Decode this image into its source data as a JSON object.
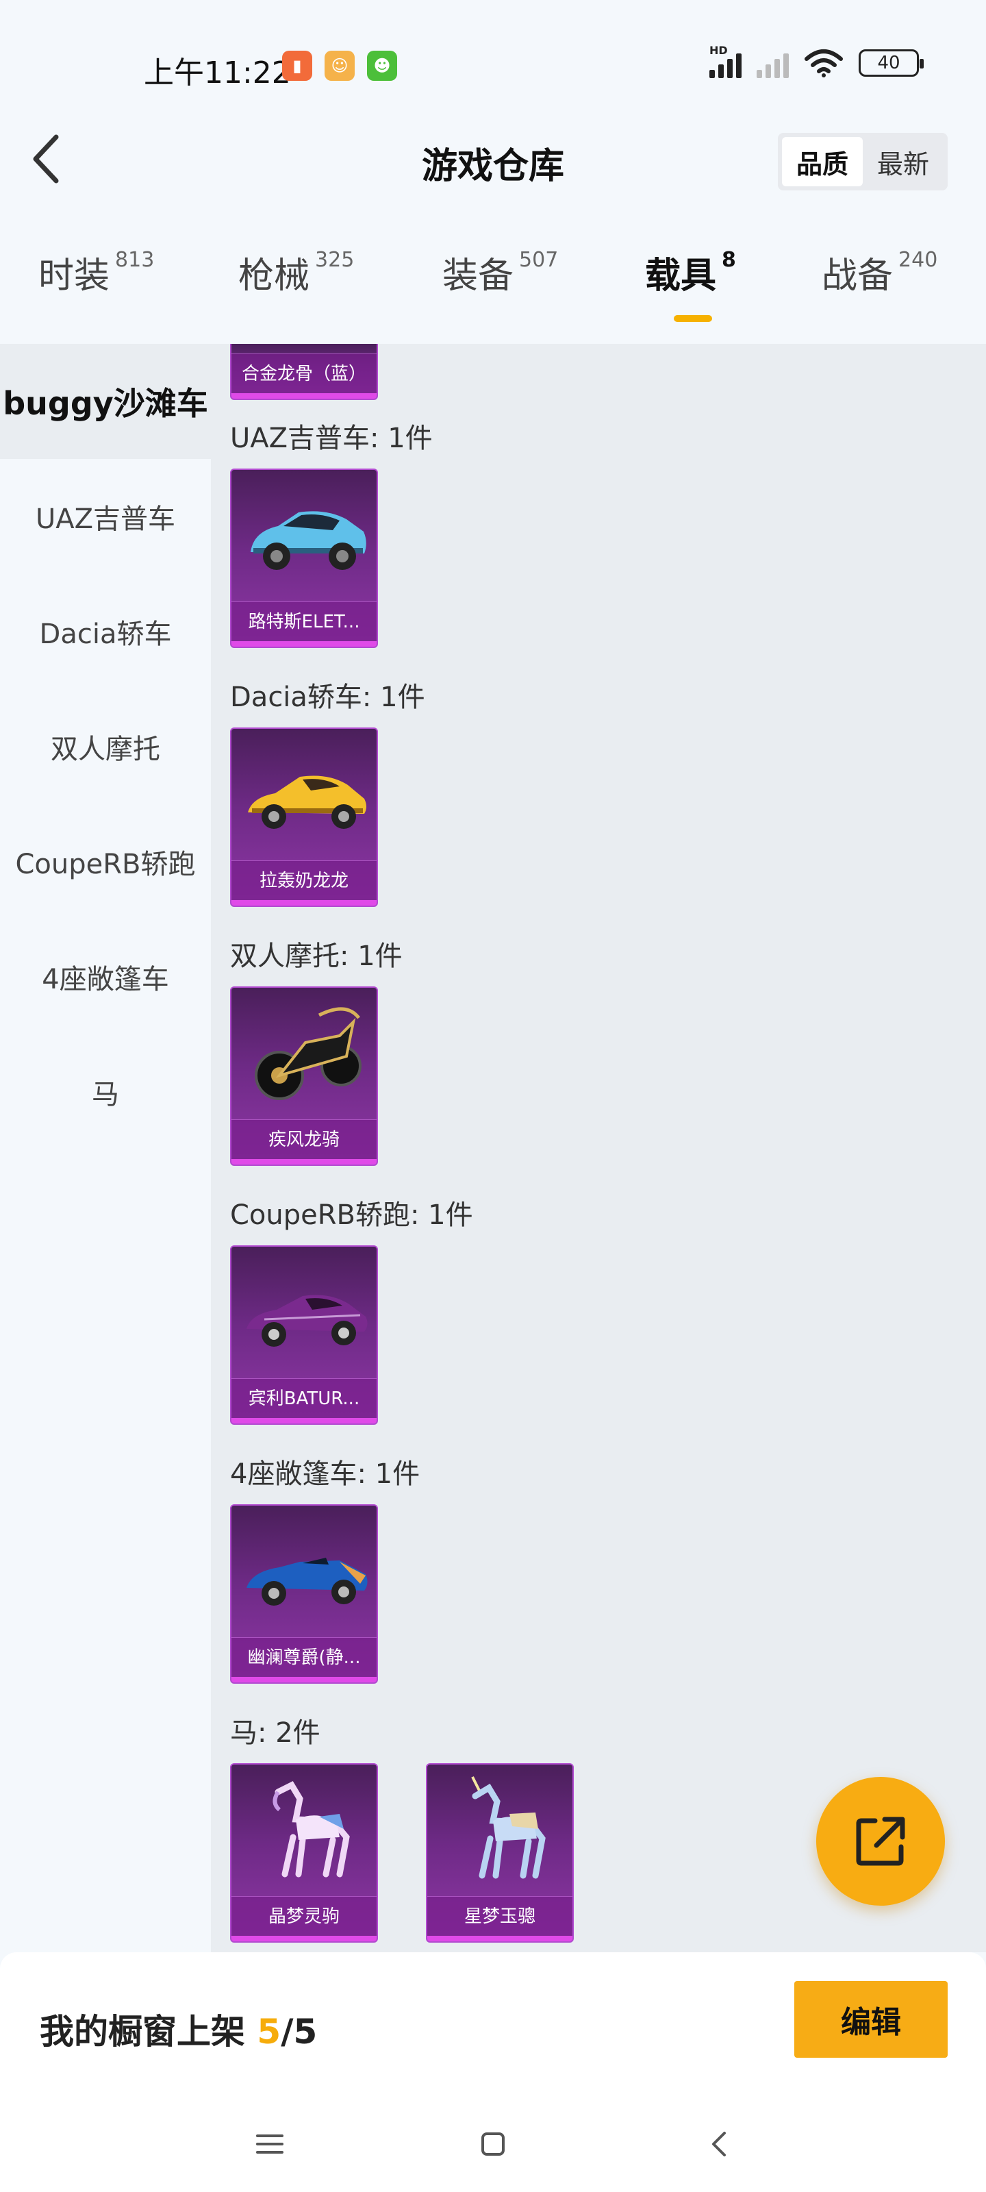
{
  "status_bar": {
    "time": "上午11:22",
    "battery": "40",
    "network_badge": "HD"
  },
  "header": {
    "title": "游戏仓库",
    "sort_options": [
      "品质",
      "最新"
    ],
    "sort_selected": "品质"
  },
  "tabs": [
    {
      "label": "时装",
      "count": "813"
    },
    {
      "label": "枪械",
      "count": "325"
    },
    {
      "label": "装备",
      "count": "507"
    },
    {
      "label": "载具",
      "count": "8"
    },
    {
      "label": "战备",
      "count": "240"
    }
  ],
  "active_tab": "载具",
  "sidebar": {
    "items": [
      "buggy沙滩车",
      "UAZ吉普车",
      "Dacia轿车",
      "双人摩托",
      "CoupeRB轿跑",
      "4座敞篷车",
      "马"
    ],
    "active": "buggy沙滩车"
  },
  "groups": [
    {
      "title": "",
      "items": [
        {
          "name": "合金龙骨（蓝）",
          "icon": "buggy-icon"
        }
      ]
    },
    {
      "title": "UAZ吉普车: 1件",
      "items": [
        {
          "name": "路特斯ELET...",
          "icon": "suv-car-icon"
        }
      ]
    },
    {
      "title": "Dacia轿车: 1件",
      "items": [
        {
          "name": "拉轰奶龙龙",
          "icon": "yellow-sports-car-icon"
        }
      ]
    },
    {
      "title": "双人摩托: 1件",
      "items": [
        {
          "name": "疾风龙骑",
          "icon": "motorcycle-icon"
        }
      ]
    },
    {
      "title": "CoupeRB轿跑: 1件",
      "items": [
        {
          "name": "宾利BATUR...",
          "icon": "coupe-car-icon"
        }
      ]
    },
    {
      "title": "4座敞篷车: 1件",
      "items": [
        {
          "name": "幽澜尊爵(静...",
          "icon": "convertible-car-icon"
        }
      ]
    },
    {
      "title": "马: 2件",
      "items": [
        {
          "name": "晶梦灵驹",
          "icon": "crystal-horse-icon"
        },
        {
          "name": "星梦玉骢",
          "icon": "unicorn-horse-icon"
        }
      ]
    }
  ],
  "bottom_bar": {
    "label": "我的橱窗上架 ",
    "current": "5",
    "separator": "/",
    "total": "5",
    "edit_label": "编辑"
  },
  "colors": {
    "accent": "#f7ac15",
    "card_purple": "#6e2a86",
    "card_border": "#b24bd0"
  }
}
